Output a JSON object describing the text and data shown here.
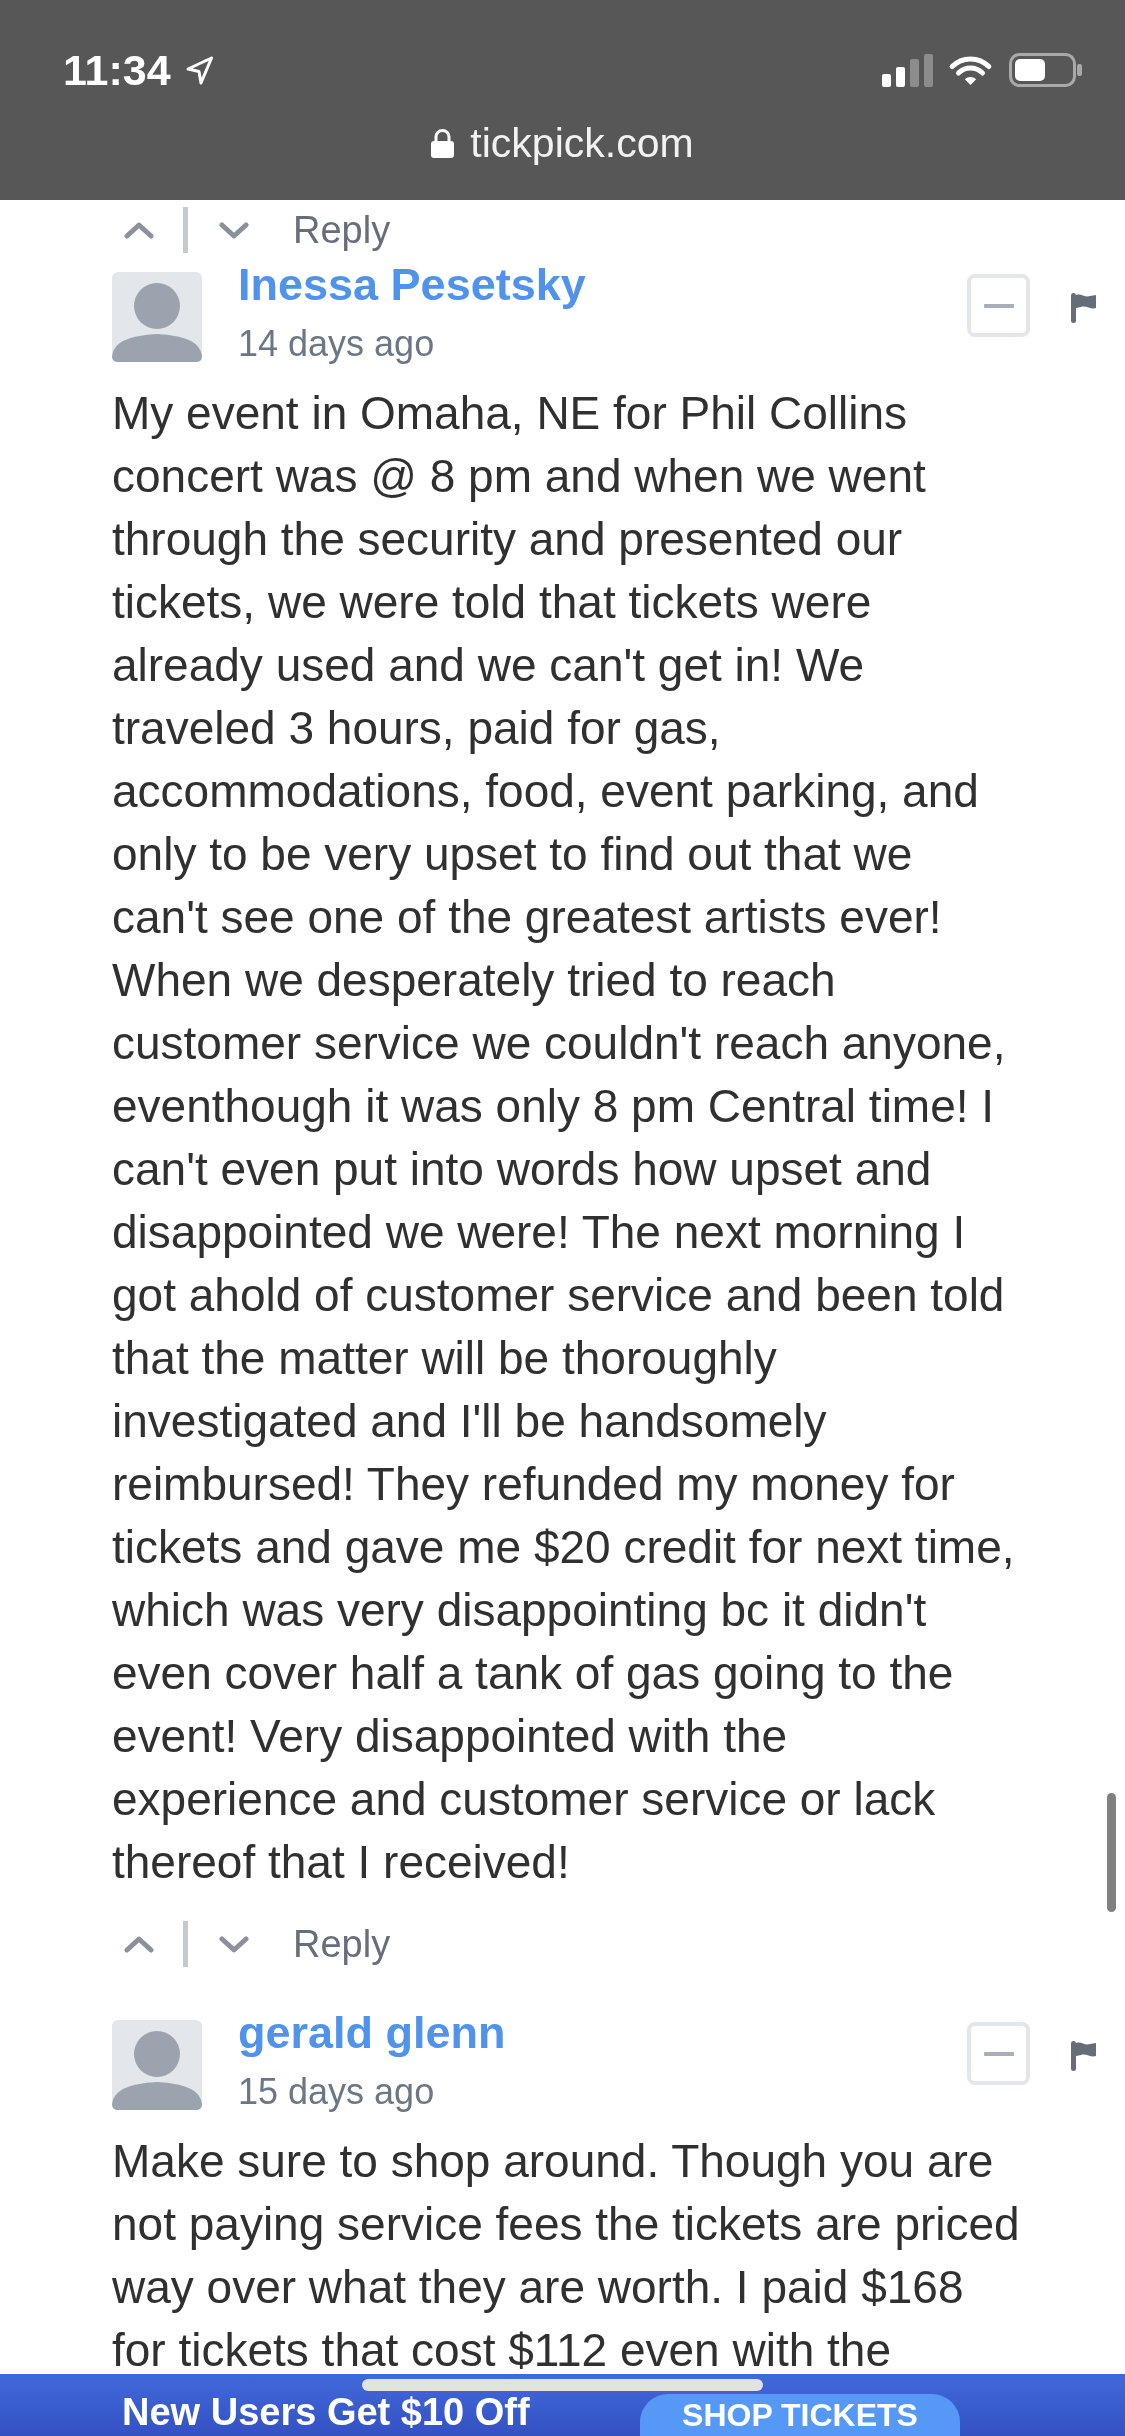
{
  "status_bar": {
    "time": "11:34"
  },
  "address_bar": {
    "url": "tickpick.com"
  },
  "preceding_comment": {
    "reply_label": "Reply"
  },
  "comments": [
    {
      "author": "Inessa Pesetsky",
      "time_ago": "14 days ago",
      "text_lines": [
        "My event in Omaha, NE for Phil Collins",
        "concert was @ 8 pm and when we went",
        "through the security and presented our",
        "tickets, we were told that tickets were",
        "already used and we can't get in! We",
        "traveled 3 hours, paid for gas,",
        "accommodations, food, event parking, and",
        "only to be very upset to find out that we",
        "can't see one of the greatest artists ever!",
        "When we desperately tried to reach",
        "customer service we couldn't reach anyone,",
        "eventhough it was only 8 pm Central time! I",
        "can't even put into words how upset and",
        "disappointed we were! The next morning I",
        "got ahold of customer service and been told",
        "that the matter will be thoroughly",
        "investigated and I'll be handsomely",
        "reimbursed! They refunded my money for",
        "tickets and gave me $20 credit for next time,",
        "which was very disappointing bc it didn't",
        "even cover half a tank of gas going to the",
        "event! Very disappointed with the",
        "experience and customer service or lack",
        "thereof that I received!"
      ],
      "reply_label": "Reply"
    },
    {
      "author": "gerald glenn",
      "time_ago": "15 days ago",
      "text_lines": [
        "Make sure to shop around. Though you are",
        "not paying service fees the tickets are priced",
        "way over what they are worth. I paid $168",
        "for tickets that cost $112 even with the"
      ]
    }
  ],
  "promo_banner": {
    "text": "New Users Get $10 Off",
    "button": "SHOP TICKETS"
  }
}
